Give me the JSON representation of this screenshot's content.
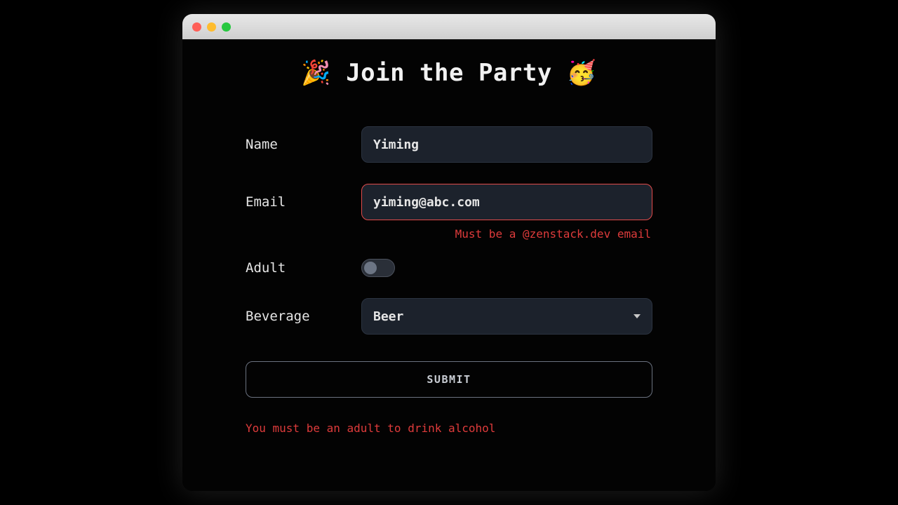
{
  "page": {
    "title": "🎉 Join the Party 🥳"
  },
  "form": {
    "name": {
      "label": "Name",
      "value": "Yiming"
    },
    "email": {
      "label": "Email",
      "value": "yiming@abc.com",
      "error": "Must be a @zenstack.dev email"
    },
    "adult": {
      "label": "Adult",
      "checked": false
    },
    "beverage": {
      "label": "Beverage",
      "selected": "Beer"
    },
    "submit": {
      "label": "SUBMIT"
    },
    "form_error": "You must be an adult to drink alcohol"
  }
}
